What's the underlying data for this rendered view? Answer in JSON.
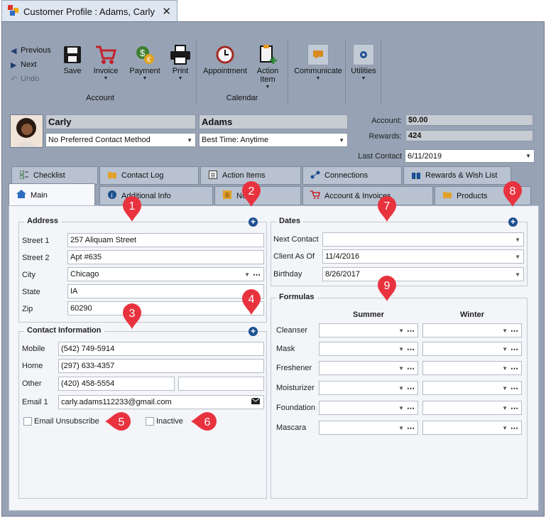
{
  "window": {
    "tab_title": "Customer Profile : Adams, Carly",
    "close_glyph": "✕"
  },
  "ribbon": {
    "nav": {
      "previous": "Previous",
      "next": "Next",
      "undo": "Undo"
    },
    "account_buttons": {
      "save": "Save",
      "invoice": "Invoice",
      "payment": "Payment",
      "print": "Print"
    },
    "account_group": "Account",
    "calendar_buttons": {
      "appointment": "Appointment",
      "action_item_line1": "Action",
      "action_item_line2": "Item"
    },
    "calendar_group": "Calendar",
    "communicate": "Communicate",
    "utilities": "Utilities"
  },
  "customer": {
    "first_name": "Carly",
    "last_name": "Adams",
    "contact_method": "No Preferred Contact Method",
    "best_time": "Best Time: Anytime",
    "account_label": "Account:",
    "account_value": "$0.00",
    "rewards_label": "Rewards:",
    "rewards_value": "424",
    "last_contact_label": "Last Contact",
    "last_contact_value": "6/11/2019"
  },
  "tabs_row1": [
    "Checklist",
    "Contact Log",
    "Action Items",
    "Connections",
    "Rewards & Wish List"
  ],
  "tabs_row2": [
    "Main",
    "Additional Info",
    "Notes",
    "Account & Invoices",
    "Products"
  ],
  "address": {
    "title": "Address",
    "street1_label": "Street 1",
    "street1": "257 Aliquam Street",
    "street2_label": "Street 2",
    "street2": "Apt #635",
    "city_label": "City",
    "city": "Chicago",
    "state_label": "State",
    "state": "IA",
    "zip_label": "Zip",
    "zip": "60290"
  },
  "contact": {
    "title": "Contact Information",
    "mobile_label": "Mobile",
    "mobile": "(542) 749-5914",
    "home_label": "Home",
    "home": "(297) 633-4357",
    "other_label": "Other",
    "other": "(420) 458-5554",
    "other_extra": "",
    "email1_label": "Email 1",
    "email1": "carly.adams112233@gmail.com",
    "email_unsubscribe": "Email Unsubscribe",
    "inactive": "Inactive"
  },
  "dates": {
    "title": "Dates",
    "next_contact_label": "Next Contact",
    "next_contact": "",
    "client_as_of_label": "Client As Of",
    "client_as_of": "11/4/2016",
    "birthday_label": "Birthday",
    "birthday": "8/26/2017"
  },
  "formulas": {
    "title": "Formulas",
    "col_summer": "Summer",
    "col_winter": "Winter",
    "rows": [
      "Cleanser",
      "Mask",
      "Freshener",
      "Moisturizer",
      "Foundation",
      "Mascara"
    ]
  },
  "markers": [
    "1",
    "2",
    "3",
    "4",
    "5",
    "6",
    "7",
    "8",
    "9"
  ],
  "colors": {
    "marker": "#e8333f",
    "frame": "#97a3b5",
    "accent": "#1d4f91"
  }
}
